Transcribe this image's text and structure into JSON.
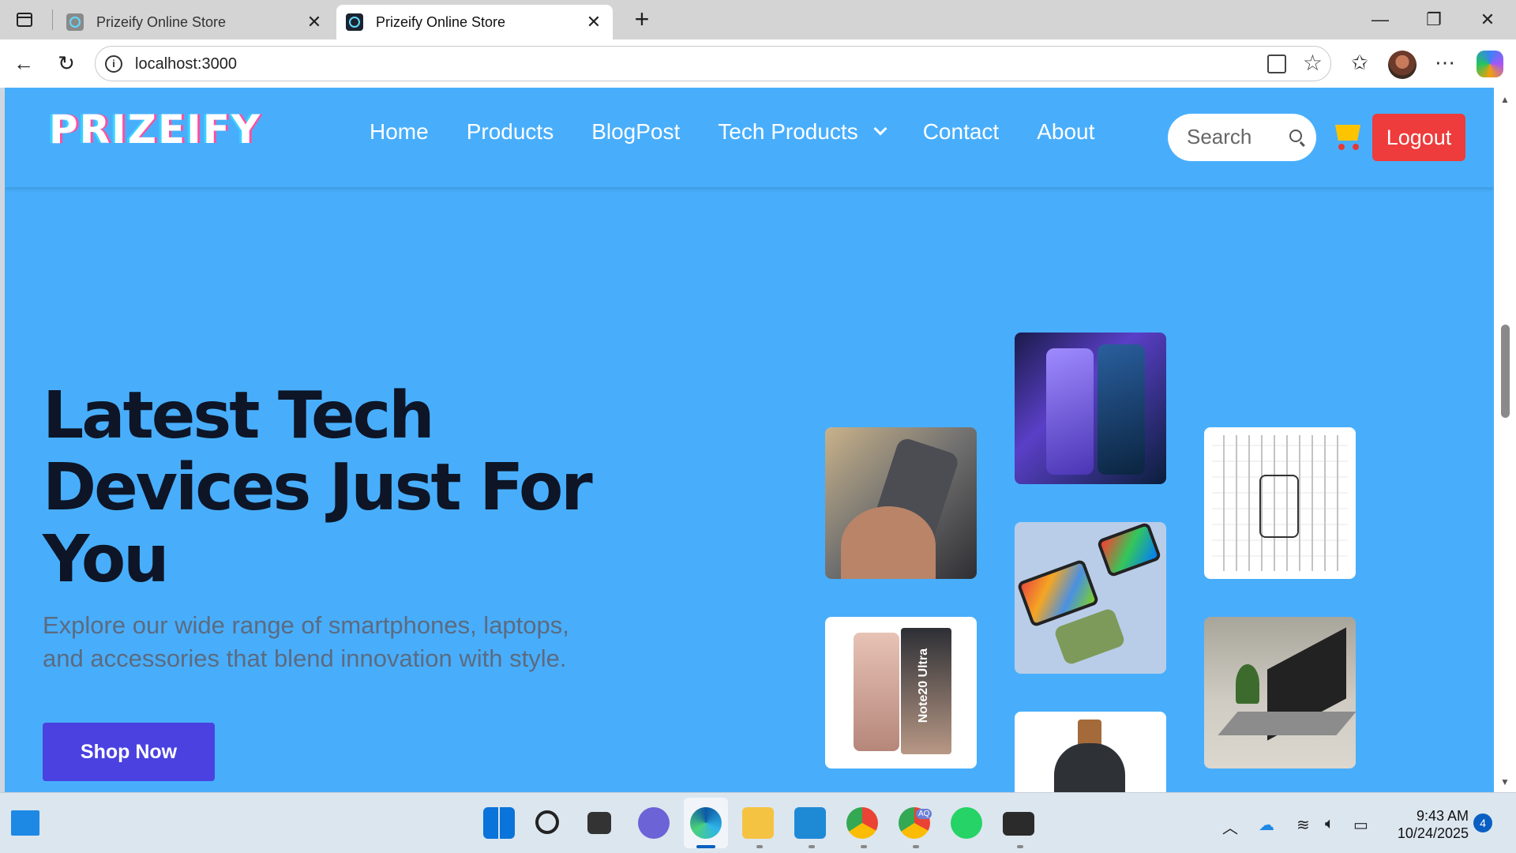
{
  "browser": {
    "tabs": [
      {
        "title": "Prizeify Online Store",
        "active": false
      },
      {
        "title": "Prizeify Online Store",
        "active": true
      }
    ],
    "url": "localhost:3000"
  },
  "site": {
    "logo": "PRIZEIFY",
    "nav": [
      "Home",
      "Products",
      "BlogPost",
      "Tech Products",
      "Contact",
      "About"
    ],
    "search_placeholder": "Search",
    "logout_label": "Logout"
  },
  "hero": {
    "title_lines": [
      "Latest Tech",
      "Devices Just For",
      "You"
    ],
    "subtitle_lines": [
      "Explore our wide range of smartphones, laptops,",
      "and accessories that blend innovation with style."
    ],
    "cta_label": "Shop Now",
    "note_box_label": "Note20 Ultra"
  },
  "taskbar": {
    "time": "9:43 AM",
    "date": "10/24/2025",
    "notifications": "4",
    "chrome_badge": "AQ"
  },
  "colors": {
    "page_bg": "#48aefc",
    "cta": "#4a41e0",
    "logout": "#ee3b3b",
    "heading": "#0d1526"
  }
}
